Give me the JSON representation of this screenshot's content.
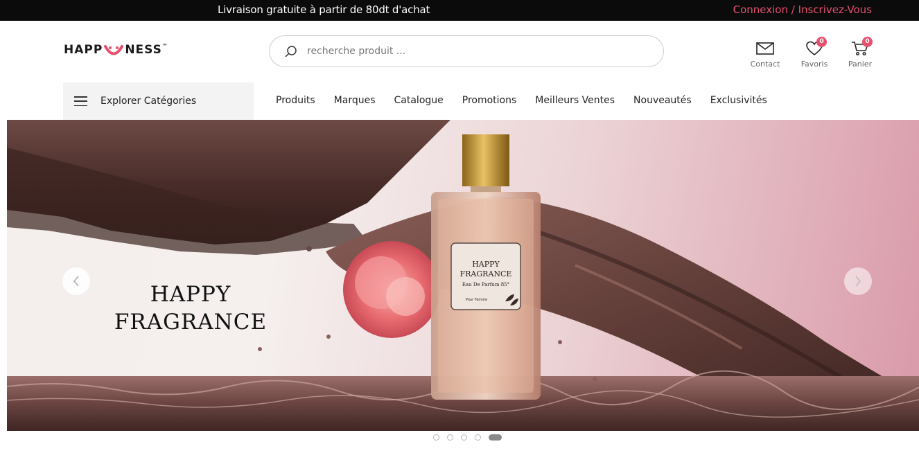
{
  "topbar": {
    "promo": "Livraison gratuite à partir de 80dt d'achat",
    "login": "Connexion",
    "separator": " / ",
    "register": "Inscrivez-Vous"
  },
  "logo": {
    "left": "HAPP",
    "right": "NESS",
    "tm": "™"
  },
  "search": {
    "placeholder": "recherche produit ..."
  },
  "header_icons": {
    "contact": {
      "label": "Contact",
      "icon": "mail-icon"
    },
    "favoris": {
      "label": "Favoris",
      "icon": "heart-icon",
      "count": "0"
    },
    "panier": {
      "label": "Panier",
      "icon": "cart-icon",
      "count": "0"
    }
  },
  "categories": {
    "label": "Explorer Catégories"
  },
  "nav": [
    "Produits",
    "Marques",
    "Catalogue",
    "Promotions",
    "Meilleurs Ventes",
    "Nouveautés",
    "Exclusivités"
  ],
  "hero": {
    "title_line1": "HAPPY",
    "title_line2": "FRAGRANCE",
    "label_line1": "HAPPY",
    "label_line2": "FRAGRANCE",
    "label_line3": "Eau De Parfum 85°",
    "label_line4": "Pour Femme"
  },
  "slider": {
    "slide_count": 5,
    "active_index": 4
  },
  "colors": {
    "accent": "#e5506f",
    "topbar": "#0b0b0b",
    "category_bg": "#f3f3f3"
  }
}
